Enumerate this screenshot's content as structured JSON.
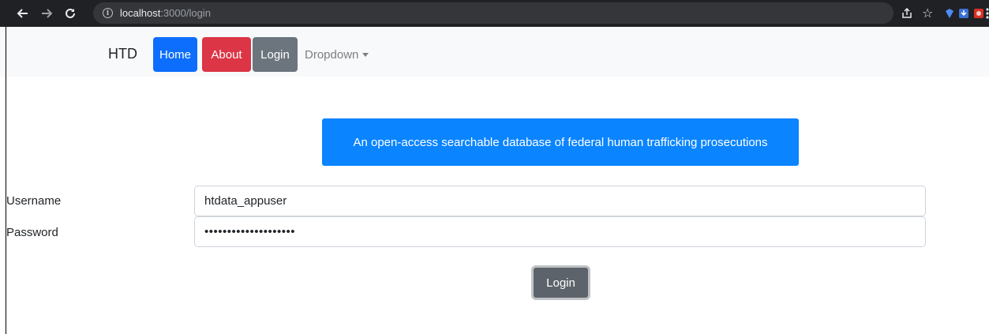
{
  "browser": {
    "url_host": "localhost",
    "url_path": ":3000/login",
    "info_glyph": "i",
    "star_glyph": "☆"
  },
  "navbar": {
    "brand": "HTD",
    "items": [
      {
        "label": "Home",
        "color": "#0d6efd"
      },
      {
        "label": "About",
        "color": "#dc3545"
      },
      {
        "label": "Login",
        "color": "#6c757d"
      }
    ],
    "dropdown_label": "Dropdown"
  },
  "banner": {
    "text": "An open-access searchable database of federal human trafficking prosecutions",
    "color": "#0a84ff"
  },
  "form": {
    "username_label": "Username",
    "username_value": "htdata_appuser",
    "password_label": "Password",
    "password_value": "xxxxxxxxxxxxxxxxxxxx",
    "submit_label": "Login"
  }
}
